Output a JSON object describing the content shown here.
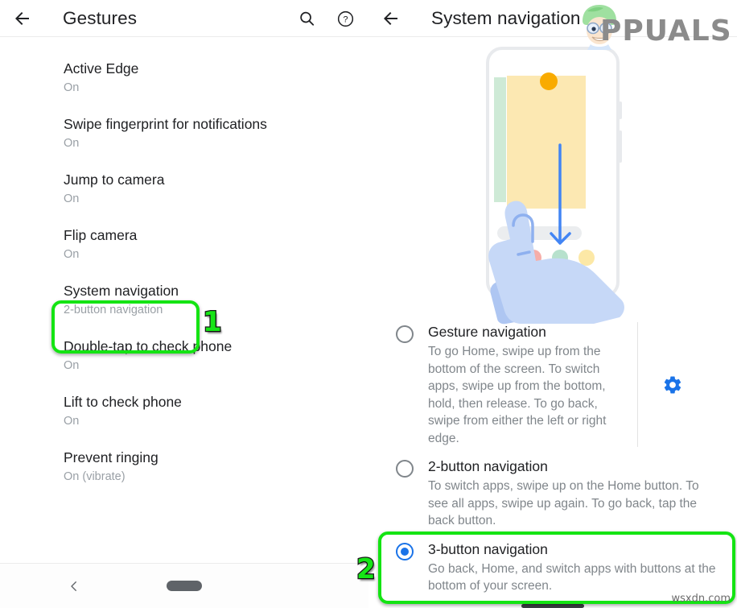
{
  "left_panel": {
    "appbar": {
      "title": "Gestures",
      "back_icon": "arrow-left-icon",
      "search_icon": "search-icon",
      "help_icon": "help-circle-icon"
    },
    "items": [
      {
        "title": "Active Edge",
        "subtitle": "On"
      },
      {
        "title": "Swipe fingerprint for notifications",
        "subtitle": "On"
      },
      {
        "title": "Jump to camera",
        "subtitle": "On"
      },
      {
        "title": "Flip camera",
        "subtitle": "On"
      },
      {
        "title": "System navigation",
        "subtitle": "2-button navigation"
      },
      {
        "title": "Double-tap to check phone",
        "subtitle": "On"
      },
      {
        "title": "Lift to check phone",
        "subtitle": "On"
      },
      {
        "title": "Prevent ringing",
        "subtitle": "On (vibrate)"
      }
    ],
    "bottom_nav": {
      "back_icon": "chevron-left-icon",
      "home_pill": "home-pill-icon"
    }
  },
  "right_panel": {
    "appbar": {
      "title": "System navigation",
      "back_icon": "arrow-left-icon"
    },
    "illustration": {
      "name": "phone-in-hand-illustration",
      "orange_dot_color": "#f9ab00",
      "card_color": "#fce8b2",
      "green_bar_color": "#ceead6",
      "hand_color": "#c6d8f7",
      "home_indicator_color": "#4285f4",
      "dots": [
        "#aecbfa",
        "#f6aea9",
        "#b7e1cd",
        "#fce8a6"
      ]
    },
    "options": [
      {
        "title": "Gesture navigation",
        "description": "To go Home, swipe up from the bottom of the screen. To switch apps, swipe up from the bottom, hold, then release. To go back, swipe from either the left or right edge.",
        "selected": false,
        "has_settings": true,
        "settings_icon": "gear-icon"
      },
      {
        "title": "2-button navigation",
        "description": "To switch apps, swipe up on the Home button. To see all apps, swipe up again. To go back, tap the back button.",
        "selected": false,
        "has_settings": false
      },
      {
        "title": "3-button navigation",
        "description": "Go back, Home, and switch apps with buttons at the bottom of your screen.",
        "selected": true,
        "has_settings": false
      }
    ]
  },
  "annotations": {
    "color": "#14e413",
    "step_1": "1",
    "step_2": "2"
  },
  "watermarks": {
    "brand": "PPUALS",
    "brand_full": "APPUALS",
    "site": "wsxdn.com"
  }
}
